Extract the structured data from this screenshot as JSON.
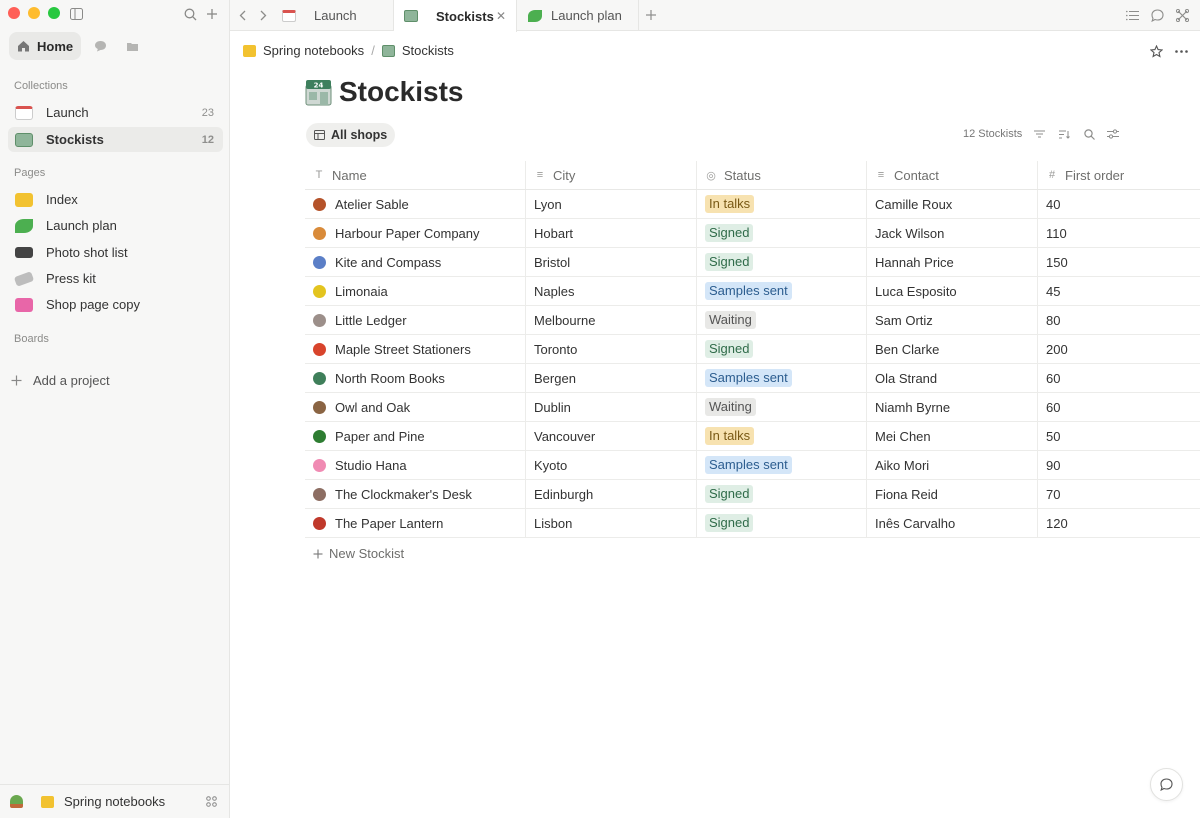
{
  "sidebar": {
    "home_label": "Home",
    "collections_label": "Collections",
    "collections": [
      {
        "label": "Launch",
        "count": "23",
        "color": "#d9534f"
      },
      {
        "label": "Stockists",
        "count": "12",
        "color": "#5f8f6a",
        "active": true
      }
    ],
    "pages_label": "Pages",
    "pages": [
      {
        "label": "Index",
        "color": "#f2c230"
      },
      {
        "label": "Launch plan",
        "color": "#4caf50"
      },
      {
        "label": "Photo shot list",
        "color": "#444444"
      },
      {
        "label": "Press kit",
        "color": "#9a9a9a"
      },
      {
        "label": "Shop page copy",
        "color": "#e866a8"
      }
    ],
    "boards_label": "Boards",
    "add_project_label": "Add a project",
    "footer_label": "Spring notebooks"
  },
  "tabs": [
    {
      "label": "Launch",
      "color": "#d9534f"
    },
    {
      "label": "Stockists",
      "color": "#5f8f6a",
      "active": true
    },
    {
      "label": "Launch plan",
      "color": "#4caf50"
    }
  ],
  "breadcrumb": {
    "parent": "Spring notebooks",
    "current": "Stockists"
  },
  "page": {
    "title": "Stockists"
  },
  "view": {
    "label": "All shops",
    "count": "12 Stockists"
  },
  "table": {
    "columns": [
      "Name",
      "City",
      "Status",
      "Contact",
      "First order"
    ],
    "rows": [
      {
        "name": "Atelier Sable",
        "city": "Lyon",
        "status": "In talks",
        "contact": "Camille Roux",
        "first_order": "40",
        "color": "#b5532a"
      },
      {
        "name": "Harbour Paper Company",
        "city": "Hobart",
        "status": "Signed",
        "contact": "Jack Wilson",
        "first_order": "110",
        "color": "#d98b3a"
      },
      {
        "name": "Kite and Compass",
        "city": "Bristol",
        "status": "Signed",
        "contact": "Hannah Price",
        "first_order": "150",
        "color": "#5b7fc7"
      },
      {
        "name": "Limonaia",
        "city": "Naples",
        "status": "Samples sent",
        "contact": "Luca Esposito",
        "first_order": "45",
        "color": "#e3c41f"
      },
      {
        "name": "Little Ledger",
        "city": "Melbourne",
        "status": "Waiting",
        "contact": "Sam Ortiz",
        "first_order": "80",
        "color": "#9c8f8a"
      },
      {
        "name": "Maple Street Stationers",
        "city": "Toronto",
        "status": "Signed",
        "contact": "Ben Clarke",
        "first_order": "200",
        "color": "#d8442c"
      },
      {
        "name": "North Room Books",
        "city": "Bergen",
        "status": "Samples sent",
        "contact": "Ola Strand",
        "first_order": "60",
        "color": "#3f7f5a"
      },
      {
        "name": "Owl and Oak",
        "city": "Dublin",
        "status": "Waiting",
        "contact": "Niamh Byrne",
        "first_order": "60",
        "color": "#8a6443"
      },
      {
        "name": "Paper and Pine",
        "city": "Vancouver",
        "status": "In talks",
        "contact": "Mei Chen",
        "first_order": "50",
        "color": "#2e7d32"
      },
      {
        "name": "Studio Hana",
        "city": "Kyoto",
        "status": "Samples sent",
        "contact": "Aiko Mori",
        "first_order": "90",
        "color": "#f08bb3"
      },
      {
        "name": "The Clockmaker's Desk",
        "city": "Edinburgh",
        "status": "Signed",
        "contact": "Fiona Reid",
        "first_order": "70",
        "color": "#8d6e63"
      },
      {
        "name": "The Paper Lantern",
        "city": "Lisbon",
        "status": "Signed",
        "contact": "Inês Carvalho",
        "first_order": "120",
        "color": "#c0392b"
      }
    ],
    "new_row_label": "New Stockist"
  }
}
